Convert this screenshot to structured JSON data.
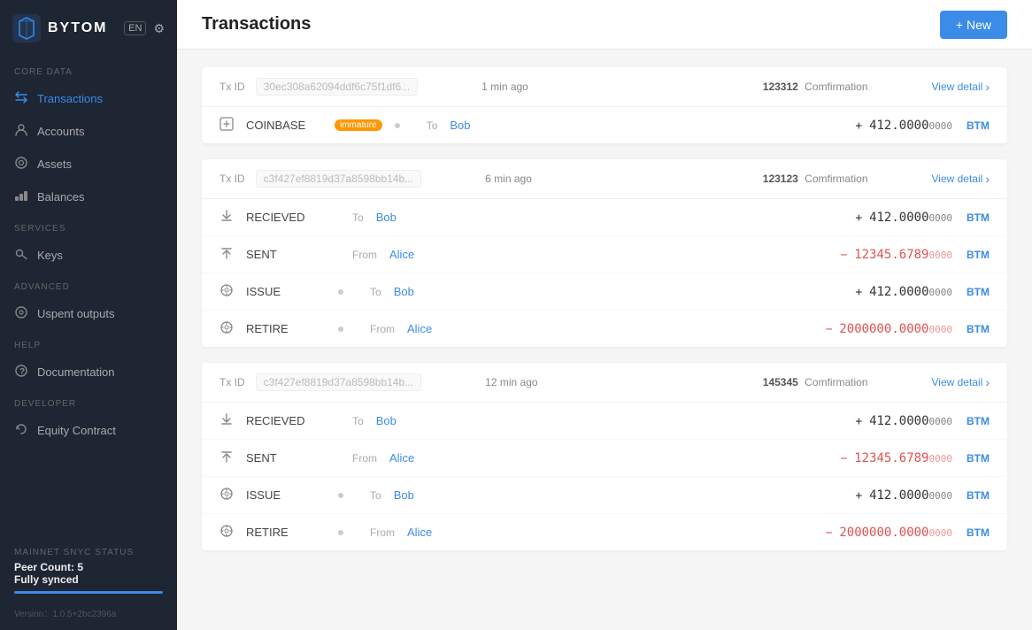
{
  "app": {
    "logo_text": "BYTOM",
    "lang": "EN",
    "version": "Version：1.0.5+2bc2396a"
  },
  "sidebar": {
    "sections": [
      {
        "label": "CORE DATA",
        "items": [
          {
            "id": "transactions",
            "label": "Transactions",
            "icon": "⇄",
            "active": true
          },
          {
            "id": "accounts",
            "label": "Accounts",
            "icon": "👤",
            "active": false
          },
          {
            "id": "assets",
            "label": "Assets",
            "icon": "◯",
            "active": false
          },
          {
            "id": "balances",
            "label": "Balances",
            "icon": "▦",
            "active": false
          }
        ]
      },
      {
        "label": "SERVICES",
        "items": [
          {
            "id": "keys",
            "label": "Keys",
            "icon": "🔑",
            "active": false
          }
        ]
      },
      {
        "label": "ADVANCED",
        "items": [
          {
            "id": "unspent-outputs",
            "label": "Uspent outputs",
            "icon": "◎",
            "active": false
          }
        ]
      },
      {
        "label": "HELP",
        "items": [
          {
            "id": "documentation",
            "label": "Documentation",
            "icon": "❓",
            "active": false
          }
        ]
      },
      {
        "label": "DEVELOPER",
        "items": [
          {
            "id": "equity-contract",
            "label": "Equity Contract",
            "icon": "↻",
            "active": false
          }
        ]
      }
    ],
    "sync": {
      "section_label": "MAINNET SNYC STATUS",
      "peer_count_label": "Peer Count: 5",
      "status_label": "Fully synced",
      "bar_pct": 100
    }
  },
  "header": {
    "title": "Transactions",
    "new_button": "+ New"
  },
  "transactions": [
    {
      "tx_id": "30ec308a62094ddf6c75f1df6...",
      "time": "1 min ago",
      "conf_num": "123312",
      "conf_label": "Comfirmation",
      "view_detail": "View detail",
      "rows": [
        {
          "icon": "⬜",
          "type": "COINBASE",
          "badge": "immature",
          "has_badge": true,
          "has_dot": true,
          "direction": "To",
          "party": "Bob",
          "amount_sign": "+",
          "amount_main": "412.0000",
          "amount_small": "0000",
          "is_negative": false,
          "currency": "BTM"
        }
      ]
    },
    {
      "tx_id": "c3f427ef8819d37a8598bb14b...",
      "time": "6 min ago",
      "conf_num": "123123",
      "conf_label": "Comfirmation",
      "view_detail": "View detail",
      "rows": [
        {
          "icon": "↑",
          "type": "RECIEVED",
          "badge": "",
          "has_badge": false,
          "has_dot": false,
          "direction": "To",
          "party": "Bob",
          "amount_sign": "+",
          "amount_main": "412.0000",
          "amount_small": "0000",
          "is_negative": false,
          "currency": "BTM"
        },
        {
          "icon": "↑",
          "type": "SENT",
          "badge": "",
          "has_badge": false,
          "has_dot": false,
          "direction": "From",
          "party": "Alice",
          "amount_sign": "−",
          "amount_main": "12345.6789",
          "amount_small": "0000",
          "is_negative": true,
          "currency": "BTM"
        },
        {
          "icon": "⚙",
          "type": "ISSUE",
          "badge": "",
          "has_badge": false,
          "has_dot": true,
          "direction": "To",
          "party": "Bob",
          "amount_sign": "+",
          "amount_main": "412.0000",
          "amount_small": "0000",
          "is_negative": false,
          "currency": "BTM"
        },
        {
          "icon": "⚙",
          "type": "RETIRE",
          "badge": "",
          "has_badge": false,
          "has_dot": true,
          "direction": "From",
          "party": "Alice",
          "amount_sign": "−",
          "amount_main": "2000000.0000",
          "amount_small": "0000",
          "is_negative": true,
          "currency": "BTM"
        }
      ]
    },
    {
      "tx_id": "c3f427ef8819d37a8598bb14b...",
      "time": "12 min ago",
      "conf_num": "145345",
      "conf_label": "Comfirmation",
      "view_detail": "View detail",
      "rows": [
        {
          "icon": "↑",
          "type": "RECIEVED",
          "badge": "",
          "has_badge": false,
          "has_dot": false,
          "direction": "To",
          "party": "Bob",
          "amount_sign": "+",
          "amount_main": "412.0000",
          "amount_small": "0000",
          "is_negative": false,
          "currency": "BTM"
        },
        {
          "icon": "↑",
          "type": "SENT",
          "badge": "",
          "has_badge": false,
          "has_dot": false,
          "direction": "From",
          "party": "Alice",
          "amount_sign": "−",
          "amount_main": "12345.6789",
          "amount_small": "0000",
          "is_negative": true,
          "currency": "BTM"
        },
        {
          "icon": "⚙",
          "type": "ISSUE",
          "badge": "",
          "has_badge": false,
          "has_dot": true,
          "direction": "To",
          "party": "Bob",
          "amount_sign": "+",
          "amount_main": "412.0000",
          "amount_small": "0000",
          "is_negative": false,
          "currency": "BTM"
        },
        {
          "icon": "⚙",
          "type": "RETIRE",
          "badge": "",
          "has_badge": false,
          "has_dot": true,
          "direction": "From",
          "party": "Alice",
          "amount_sign": "−",
          "amount_main": "2000000.0000",
          "amount_small": "0000",
          "is_negative": true,
          "currency": "BTM"
        }
      ]
    }
  ]
}
